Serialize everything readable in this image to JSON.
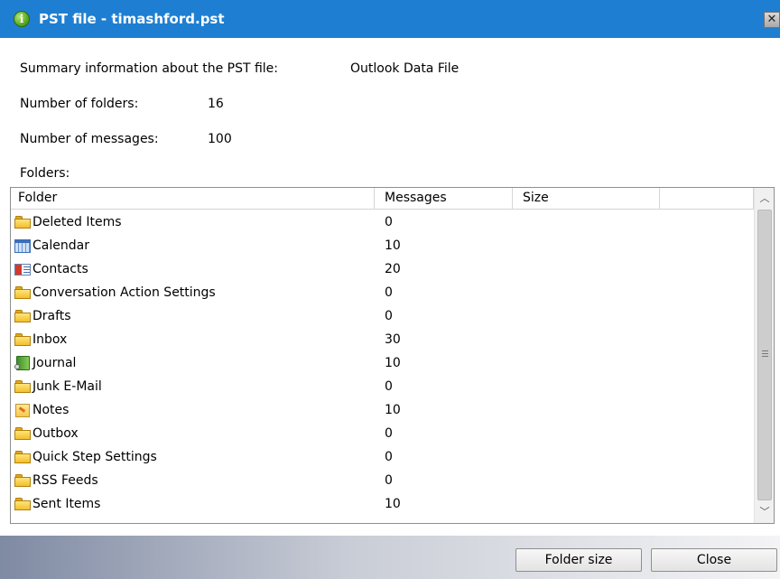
{
  "window": {
    "title": "PST file - timashford.pst",
    "close_glyph": "✕",
    "info_icon_glyph": "i"
  },
  "summary": {
    "label": "Summary information about the PST file:",
    "value": "Outlook Data File",
    "folders_label": "Number of folders:",
    "folders_value": "16",
    "messages_label": "Number of messages:",
    "messages_value": "100",
    "folders_section_label": "Folders:"
  },
  "grid": {
    "columns": [
      "Folder",
      "Messages",
      "Size",
      ""
    ],
    "rows": [
      {
        "name": "Deleted Items",
        "messages": "0",
        "icon": "folder-icon"
      },
      {
        "name": "Calendar",
        "messages": "10",
        "icon": "calendar-icon"
      },
      {
        "name": "Contacts",
        "messages": "20",
        "icon": "contacts-icon"
      },
      {
        "name": "Conversation Action Settings",
        "messages": "0",
        "icon": "folder-icon"
      },
      {
        "name": "Drafts",
        "messages": "0",
        "icon": "folder-icon"
      },
      {
        "name": "Inbox",
        "messages": "30",
        "icon": "folder-icon"
      },
      {
        "name": "Journal",
        "messages": "10",
        "icon": "journal-icon"
      },
      {
        "name": "Junk E-Mail",
        "messages": "0",
        "icon": "folder-icon"
      },
      {
        "name": "Notes",
        "messages": "10",
        "icon": "notes-icon"
      },
      {
        "name": "Outbox",
        "messages": "0",
        "icon": "folder-icon"
      },
      {
        "name": "Quick Step Settings",
        "messages": "0",
        "icon": "folder-icon"
      },
      {
        "name": "RSS Feeds",
        "messages": "0",
        "icon": "folder-icon"
      },
      {
        "name": "Sent Items",
        "messages": "10",
        "icon": "folder-icon"
      }
    ],
    "scroll_up_glyph": "︿",
    "scroll_down_glyph": "﹀"
  },
  "buttons": {
    "folder_size": "Folder size",
    "close": "Close"
  },
  "colors": {
    "titlebar": "#1e7fd2",
    "folder": "#f3bf2c"
  }
}
